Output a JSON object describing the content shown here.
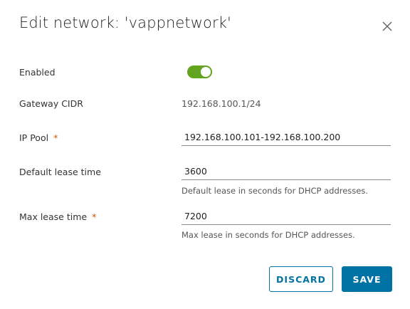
{
  "dialog": {
    "title": "Edit network: 'vappnetwork'",
    "close_icon": "close-icon"
  },
  "form": {
    "enabled": {
      "label": "Enabled",
      "value": true,
      "color": "#62a420"
    },
    "gateway_cidr": {
      "label": "Gateway CIDR",
      "value": "192.168.100.1/24"
    },
    "ip_pool": {
      "label": "IP Pool",
      "required_marker": "*",
      "value": "192.168.100.101-192.168.100.200"
    },
    "default_lease_time": {
      "label": "Default lease time",
      "value": "3600",
      "helper": "Default lease in seconds for DHCP addresses."
    },
    "max_lease_time": {
      "label": "Max lease time",
      "required_marker": "*",
      "value": "7200",
      "helper": "Max lease in seconds for DHCP addresses."
    }
  },
  "footer": {
    "discard_label": "DISCARD",
    "save_label": "SAVE",
    "primary_color": "#0072a3"
  }
}
